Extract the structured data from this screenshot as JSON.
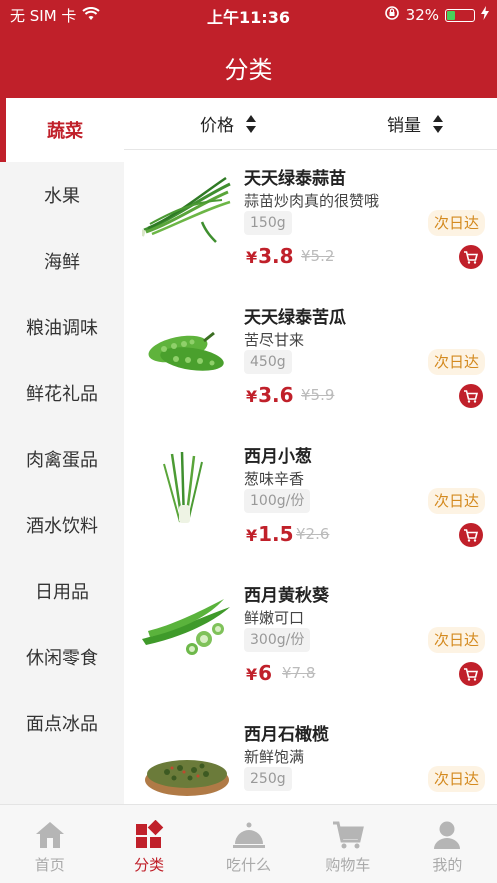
{
  "status_bar": {
    "carrier": "无 SIM 卡",
    "time": "上午11:36",
    "battery": "32%",
    "battery_level": 0.32
  },
  "header": {
    "title": "分类"
  },
  "sidebar": {
    "items": [
      {
        "label": "蔬菜",
        "active": true
      },
      {
        "label": "水果"
      },
      {
        "label": "海鲜"
      },
      {
        "label": "粮油调味"
      },
      {
        "label": "鲜花礼品"
      },
      {
        "label": "肉禽蛋品"
      },
      {
        "label": "酒水饮料"
      },
      {
        "label": "日用品"
      },
      {
        "label": "休闲零食"
      },
      {
        "label": "面点冰品"
      }
    ]
  },
  "sort": {
    "price_label": "价格",
    "sales_label": "销量"
  },
  "products": [
    {
      "name": "天天绿泰蒜苗",
      "desc": "蒜苗炒肉真的很赞哦",
      "spec": "150g",
      "price": "3.8",
      "original_price": "¥5.2",
      "badge": "次日达",
      "icon": "garlic-sprout"
    },
    {
      "name": "天天绿泰苦瓜",
      "desc": "苦尽甘来",
      "spec": "450g",
      "price": "3.6",
      "original_price": "¥5.9",
      "badge": "次日达",
      "icon": "bitter-melon"
    },
    {
      "name": "西月小葱",
      "desc": "葱味辛香",
      "spec": "100g/份",
      "price": "1.5",
      "original_price": "¥2.6",
      "badge": "次日达",
      "icon": "scallion"
    },
    {
      "name": "西月黄秋葵",
      "desc": "鲜嫩可口",
      "spec": "300g/份",
      "price": "6",
      "original_price": "¥7.8",
      "badge": "次日达",
      "icon": "okra"
    },
    {
      "name": "西月石橄榄",
      "desc": "新鲜饱满",
      "spec": "250g",
      "price": "",
      "original_price": "",
      "badge": "次日达",
      "icon": "herb-basket"
    }
  ],
  "currency": "¥",
  "tabbar": {
    "items": [
      {
        "label": "首页",
        "icon": "home-icon"
      },
      {
        "label": "分类",
        "icon": "category-icon",
        "active": true
      },
      {
        "label": "吃什么",
        "icon": "cloche-icon"
      },
      {
        "label": "购物车",
        "icon": "cart-icon"
      },
      {
        "label": "我的",
        "icon": "user-icon"
      }
    ]
  },
  "colors": {
    "brand": "#c0202a",
    "badge_bg": "#fdf3e3",
    "badge_text": "#d48a1f"
  }
}
